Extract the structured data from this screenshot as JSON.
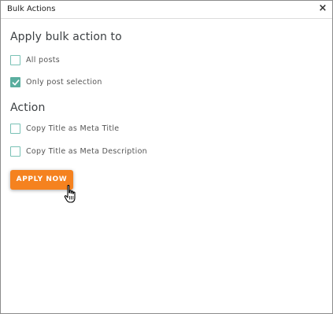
{
  "dialog": {
    "title": "Bulk Actions",
    "close_glyph": "×"
  },
  "apply_section": {
    "heading": "Apply bulk action to",
    "options": [
      {
        "label": "All posts",
        "checked": false
      },
      {
        "label": "Only post selection",
        "checked": true
      }
    ]
  },
  "action_section": {
    "heading": "Action",
    "options": [
      {
        "label": "Copy Title as Meta Title",
        "checked": false
      },
      {
        "label": "Copy Title as Meta Description",
        "checked": false
      }
    ]
  },
  "apply_button": {
    "label": "APPLY NOW",
    "color": "#f5821f"
  },
  "colors": {
    "checkbox_border": "#79c1b5",
    "checkbox_checked": "#5aae9f"
  },
  "icons": {
    "close": "close-icon",
    "check": "checkmark-icon",
    "cursor": "hand-pointer-cursor-icon"
  }
}
